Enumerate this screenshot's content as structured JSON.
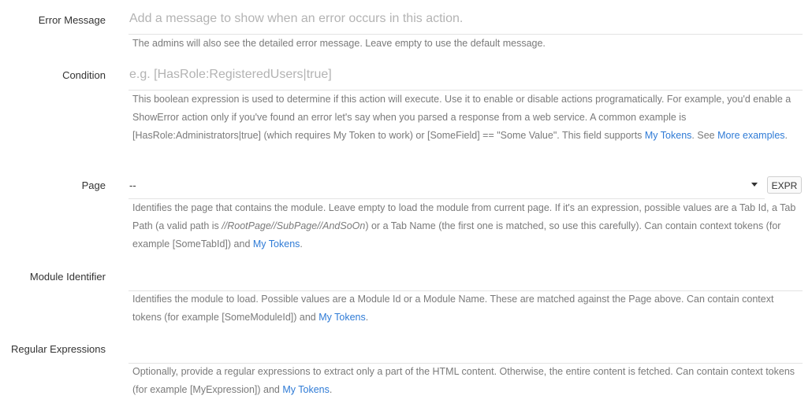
{
  "error_message": {
    "label": "Error Message",
    "placeholder": "Add a message to show when an error occurs in this action.",
    "help": "The admins will also see the detailed error message. Leave empty to use the default message."
  },
  "condition": {
    "label": "Condition",
    "placeholder": "e.g. [HasRole:RegisteredUsers|true]",
    "help_text": "This boolean expression is used to determine if this action will execute. Use it to enable or disable actions programatically. For example, you'd enable a ShowError action only if you've found an error let's say when you parsed a response from a web service. A common example is [HasRole:Administrators|true] (which requires My Token to work) or [SomeField] == \"Some Value\". This field supports ",
    "link_tokens": "My Tokens",
    "help_mid": ". See ",
    "link_examples": "More examples",
    "help_end": "."
  },
  "page": {
    "label": "Page",
    "selected": "--",
    "expr_button": "EXPR",
    "help_start": "Identifies the page that contains the module. Leave empty to load the module from current page. If it's an expression, possible values are a Tab Id, a Tab Path (a valid path is ",
    "help_path": "//RootPage//SubPage//AndSoOn",
    "help_rest": ") or a Tab Name (the first one is matched, so use this carefully). Can contain context tokens (for example [SomeTabId]) and ",
    "link_tokens": "My Tokens",
    "help_end": "."
  },
  "module_identifier": {
    "label": "Module Identifier",
    "help_text": "Identifies the module to load. Possible values are a Module Id or a Module Name. These are matched against the Page above. Can contain context tokens (for example [SomeModuleId]) and ",
    "link_tokens": "My Tokens",
    "help_end": "."
  },
  "regular_expressions": {
    "label": "Regular Expressions",
    "help_text": "Optionally, provide a regular expressions to extract only a part of the HTML content. Otherwise, the entire content is fetched. Can contain context tokens (for example [MyExpression]) and ",
    "link_tokens": "My Tokens",
    "help_end": "."
  }
}
